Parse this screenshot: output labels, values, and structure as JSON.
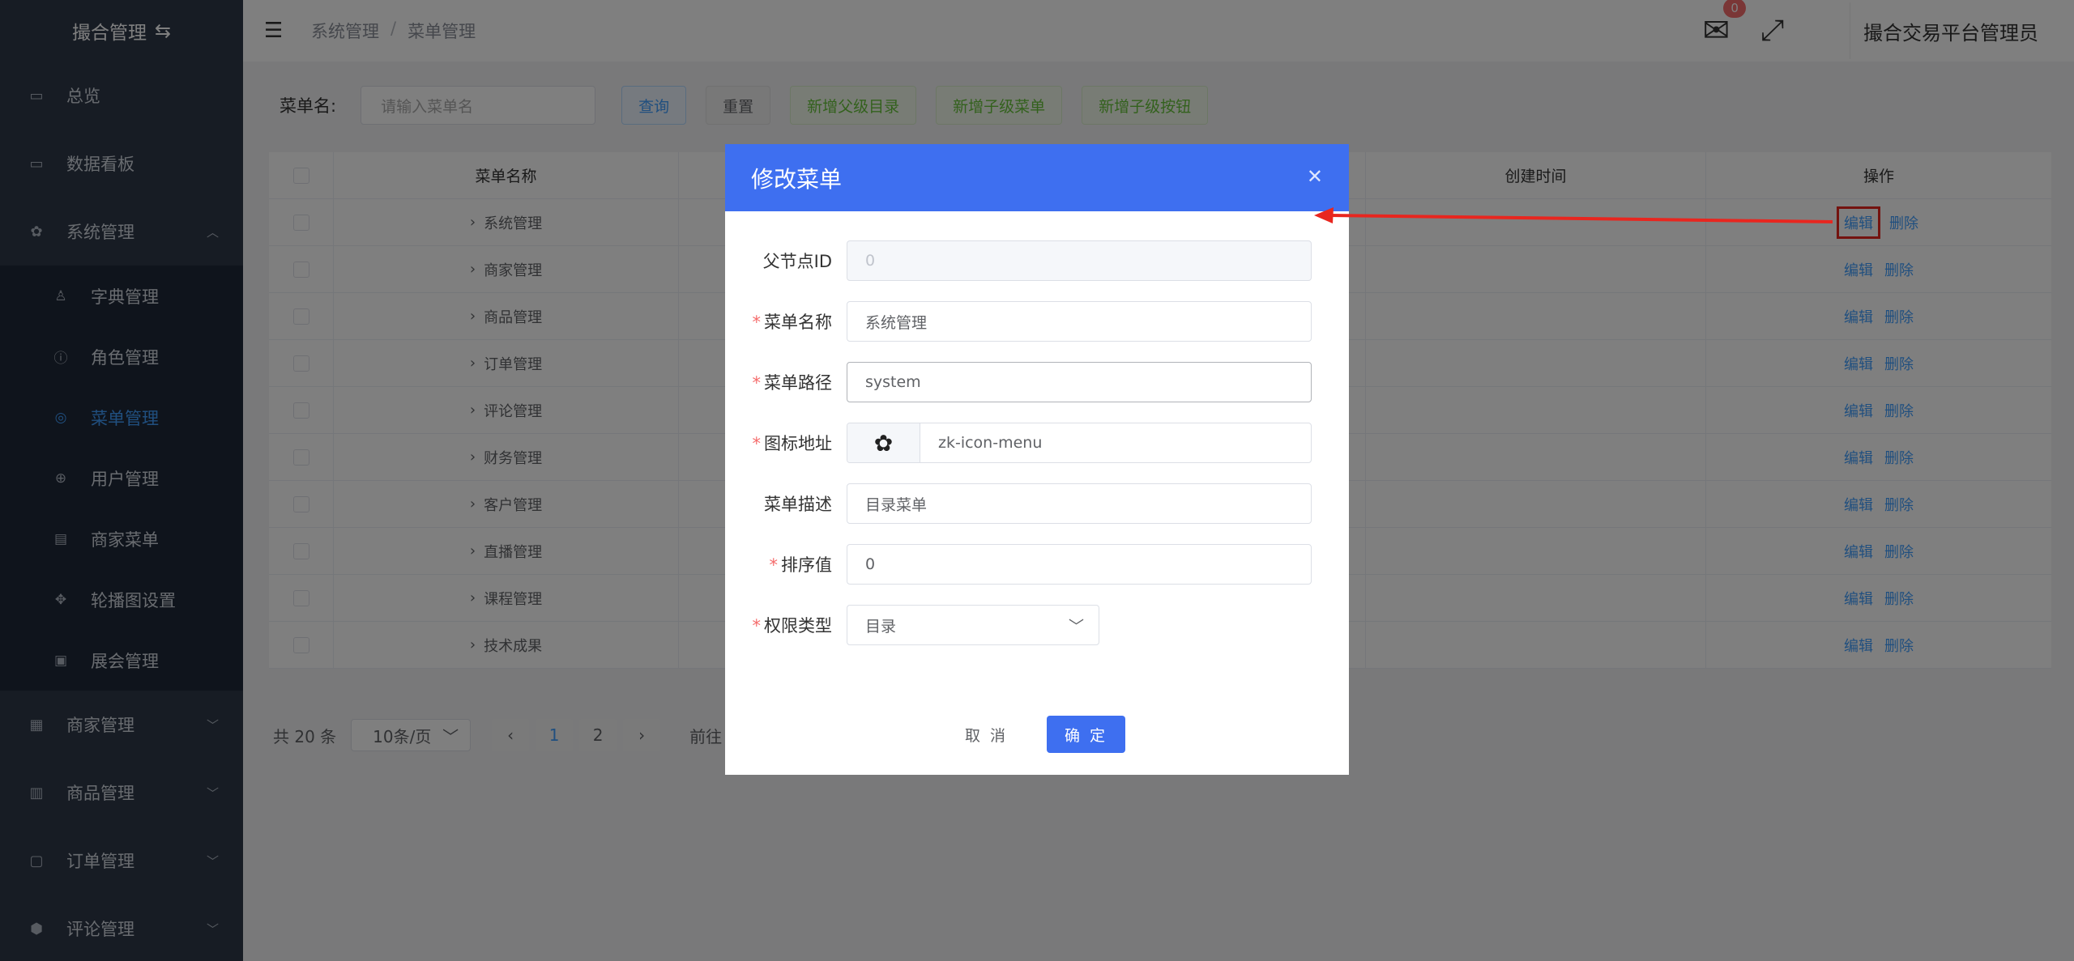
{
  "sidebar": {
    "brand": "撮合管理",
    "items_top": [
      {
        "label": "总览",
        "icon": "monitor-icon"
      },
      {
        "label": "数据看板",
        "icon": "monitor-icon"
      },
      {
        "label": "系统管理",
        "icon": "gear-icon"
      }
    ],
    "submenu": [
      {
        "label": "字典管理",
        "icon": "user-icon"
      },
      {
        "label": "角色管理",
        "icon": "info-circle-icon"
      },
      {
        "label": "菜单管理",
        "icon": "location-icon",
        "active": true
      },
      {
        "label": "用户管理",
        "icon": "zoom-icon"
      },
      {
        "label": "商家菜单",
        "icon": "box-icon"
      },
      {
        "label": "轮播图设置",
        "icon": "move-icon"
      },
      {
        "label": "展会管理",
        "icon": "frame-icon"
      }
    ],
    "items_bottom": [
      {
        "label": "商家管理",
        "icon": "shop-icon"
      },
      {
        "label": "商品管理",
        "icon": "gift-icon"
      },
      {
        "label": "订单管理",
        "icon": "document-icon"
      },
      {
        "label": "评论管理",
        "icon": "shield-icon"
      }
    ]
  },
  "header": {
    "breadcrumb": [
      "系统管理",
      "菜单管理"
    ],
    "badge_count": "0",
    "username": "撮合交易平台管理员"
  },
  "search": {
    "label": "菜单名:",
    "placeholder": "请输入菜单名",
    "buttons": [
      "查询",
      "重置",
      "新增父级目录",
      "新增子级菜单",
      "新增子级按钮"
    ]
  },
  "table": {
    "headers": {
      "name": "菜单名称",
      "created": "创建时间",
      "ops": "操作"
    },
    "rows": [
      "系统管理",
      "商家管理",
      "商品管理",
      "订单管理",
      "评论管理",
      "财务管理",
      "客户管理",
      "直播管理",
      "课程管理",
      "技术成果"
    ],
    "edit_label": "编辑",
    "delete_label": "删除"
  },
  "pagination": {
    "total": "共 20 条",
    "page_size": "10条/页",
    "pages": [
      "1",
      "2"
    ],
    "current": "1",
    "goto": "前往"
  },
  "dialog": {
    "title": "修改菜单",
    "fields": {
      "parent_id": {
        "label": "父节点ID",
        "value": "0",
        "required": false
      },
      "menu_name": {
        "label": "菜单名称",
        "value": "系统管理",
        "required": true
      },
      "menu_path": {
        "label": "菜单路径",
        "value": "system",
        "required": true
      },
      "icon_addr": {
        "label": "图标地址",
        "value": "zk-icon-menu",
        "required": true
      },
      "menu_desc": {
        "label": "菜单描述",
        "value": "目录菜单",
        "required": false
      },
      "sort_value": {
        "label": "排序值",
        "value": "0",
        "required": true
      },
      "perm_type": {
        "label": "权限类型",
        "value": "目录",
        "required": true
      }
    },
    "cancel_label": "取 消",
    "confirm_label": "确 定"
  },
  "colors": {
    "sidebar_bg": "#2e3849",
    "accent": "#409eff",
    "dialog_header": "#3e6ff0",
    "annotation_red": "#e8261f"
  }
}
